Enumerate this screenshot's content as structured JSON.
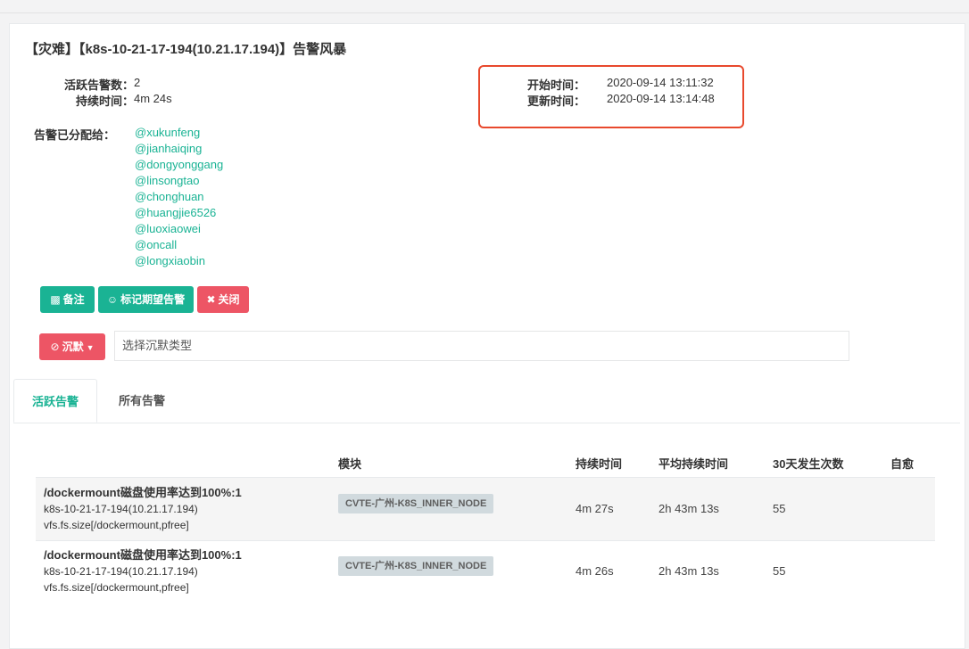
{
  "header": {
    "title": "【灾难】【k8s-10-21-17-194(10.21.17.194)】告警风暴"
  },
  "summary": {
    "active_count_label": "活跃告警数：",
    "active_count_value": "2",
    "duration_label": "持续时间：",
    "duration_value": "4m 24s",
    "start_label": "开始时间：",
    "start_value": "2020-09-14 13:11:32",
    "update_label": "更新时间：",
    "update_value": "2020-09-14 13:14:48",
    "assigned_label": "告警已分配给：",
    "assignees": [
      "@xukunfeng",
      "@jianhaiqing",
      "@dongyonggang",
      "@linsongtao",
      "@chonghuan",
      "@huangjie6526",
      "@luoxiaowei",
      "@oncall",
      "@longxiaobin"
    ]
  },
  "actions": {
    "note_label": "备注",
    "mark_label": "标记期望告警",
    "close_label": "关闭",
    "silence_label": "沉默",
    "silence_placeholder": "选择沉默类型"
  },
  "tabs": [
    {
      "label": "活跃告警"
    },
    {
      "label": "所有告警"
    }
  ],
  "table": {
    "headers": {
      "module": "模块",
      "duration": "持续时间",
      "avg_duration": "平均持续时间",
      "count_30d": "30天发生次数",
      "self_heal": "自愈"
    },
    "rows": [
      {
        "line1": "/dockermount磁盘使用率达到100%:1",
        "line2": "k8s-10-21-17-194(10.21.17.194)",
        "line3": "vfs.fs.size[/dockermount,pfree]",
        "module": "CVTE-广州-K8S_INNER_NODE",
        "duration": "4m 27s",
        "avg_duration": "2h 43m 13s",
        "count_30d": "55",
        "self_heal": ""
      },
      {
        "line1": "/dockermount磁盘使用率达到100%:1",
        "line2": "k8s-10-21-17-194(10.21.17.194)",
        "line3": "vfs.fs.size[/dockermount,pfree]",
        "module": "CVTE-广州-K8S_INNER_NODE",
        "duration": "4m 26s",
        "avg_duration": "2h 43m 13s",
        "count_30d": "55",
        "self_heal": ""
      }
    ]
  },
  "colors": {
    "accent": "#1ab394",
    "danger": "#ed5565",
    "highlight_box": "#e8492d"
  }
}
